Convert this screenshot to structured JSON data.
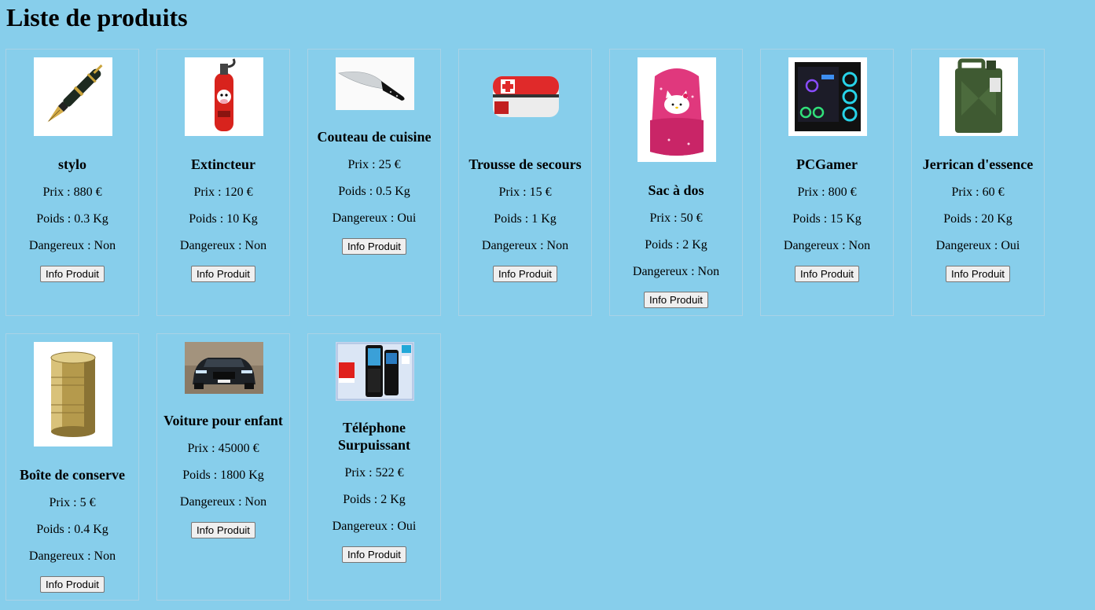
{
  "page": {
    "title": "Liste de produits"
  },
  "labels": {
    "prix_prefix": "Prix : ",
    "poids_prefix": "Poids : ",
    "dangereux_prefix": "Dangereux : ",
    "button": "Info Produit"
  },
  "products": [
    {
      "name": "stylo",
      "prix": "880 €",
      "poids": "0.3 Kg",
      "dangereux": "Non",
      "image": "fountain-pen"
    },
    {
      "name": "Extincteur",
      "prix": "120 €",
      "poids": "10 Kg",
      "dangereux": "Non",
      "image": "fire-extinguisher"
    },
    {
      "name": "Couteau de cuisine",
      "prix": "25 €",
      "poids": "0.5 Kg",
      "dangereux": "Oui",
      "image": "kitchen-knife"
    },
    {
      "name": "Trousse de secours",
      "prix": "15 €",
      "poids": "1 Kg",
      "dangereux": "Non",
      "image": "first-aid-kit"
    },
    {
      "name": "Sac à dos",
      "prix": "50 €",
      "poids": "2 Kg",
      "dangereux": "Non",
      "image": "hello-kitty-backpack"
    },
    {
      "name": "PCGamer",
      "prix": "800 €",
      "poids": "15 Kg",
      "dangereux": "Non",
      "image": "gaming-pc"
    },
    {
      "name": "Jerrican d'essence",
      "prix": "60 €",
      "poids": "20 Kg",
      "dangereux": "Oui",
      "image": "jerrycan"
    },
    {
      "name": "Boîte de conserve",
      "prix": "5 €",
      "poids": "0.4 Kg",
      "dangereux": "Non",
      "image": "tin-can"
    },
    {
      "name": "Voiture pour enfant",
      "prix": "45000 €",
      "poids": "1800 Kg",
      "dangereux": "Non",
      "image": "car"
    },
    {
      "name": "Téléphone Surpuissant",
      "prix": "522 €",
      "poids": "2 Kg",
      "dangereux": "Oui",
      "image": "mobile-phone"
    }
  ]
}
